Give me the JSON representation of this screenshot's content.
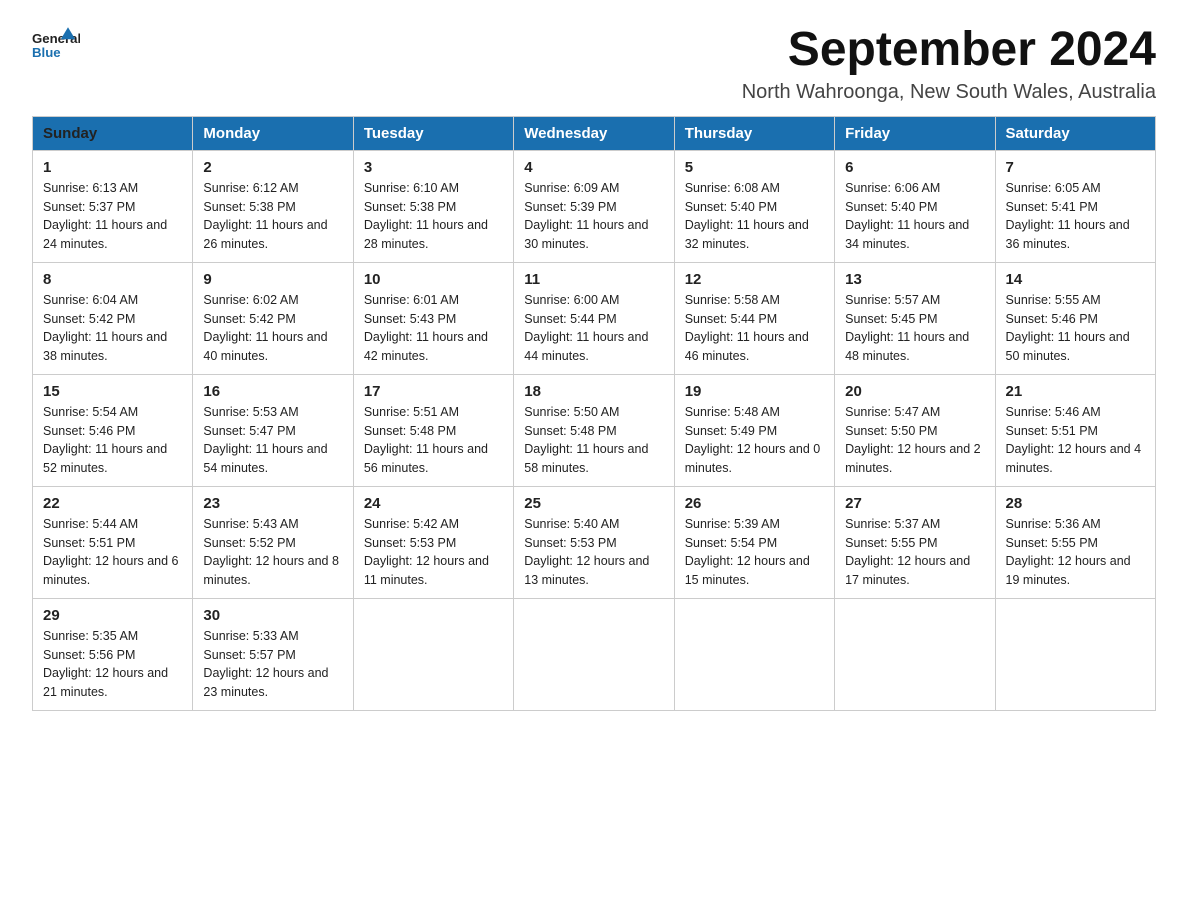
{
  "logo": {
    "general": "General",
    "blue": "Blue"
  },
  "title": "September 2024",
  "location": "North Wahroonga, New South Wales, Australia",
  "weekdays": [
    "Sunday",
    "Monday",
    "Tuesday",
    "Wednesday",
    "Thursday",
    "Friday",
    "Saturday"
  ],
  "weeks": [
    [
      {
        "day": "1",
        "sunrise": "6:13 AM",
        "sunset": "5:37 PM",
        "daylight": "11 hours and 24 minutes."
      },
      {
        "day": "2",
        "sunrise": "6:12 AM",
        "sunset": "5:38 PM",
        "daylight": "11 hours and 26 minutes."
      },
      {
        "day": "3",
        "sunrise": "6:10 AM",
        "sunset": "5:38 PM",
        "daylight": "11 hours and 28 minutes."
      },
      {
        "day": "4",
        "sunrise": "6:09 AM",
        "sunset": "5:39 PM",
        "daylight": "11 hours and 30 minutes."
      },
      {
        "day": "5",
        "sunrise": "6:08 AM",
        "sunset": "5:40 PM",
        "daylight": "11 hours and 32 minutes."
      },
      {
        "day": "6",
        "sunrise": "6:06 AM",
        "sunset": "5:40 PM",
        "daylight": "11 hours and 34 minutes."
      },
      {
        "day": "7",
        "sunrise": "6:05 AM",
        "sunset": "5:41 PM",
        "daylight": "11 hours and 36 minutes."
      }
    ],
    [
      {
        "day": "8",
        "sunrise": "6:04 AM",
        "sunset": "5:42 PM",
        "daylight": "11 hours and 38 minutes."
      },
      {
        "day": "9",
        "sunrise": "6:02 AM",
        "sunset": "5:42 PM",
        "daylight": "11 hours and 40 minutes."
      },
      {
        "day": "10",
        "sunrise": "6:01 AM",
        "sunset": "5:43 PM",
        "daylight": "11 hours and 42 minutes."
      },
      {
        "day": "11",
        "sunrise": "6:00 AM",
        "sunset": "5:44 PM",
        "daylight": "11 hours and 44 minutes."
      },
      {
        "day": "12",
        "sunrise": "5:58 AM",
        "sunset": "5:44 PM",
        "daylight": "11 hours and 46 minutes."
      },
      {
        "day": "13",
        "sunrise": "5:57 AM",
        "sunset": "5:45 PM",
        "daylight": "11 hours and 48 minutes."
      },
      {
        "day": "14",
        "sunrise": "5:55 AM",
        "sunset": "5:46 PM",
        "daylight": "11 hours and 50 minutes."
      }
    ],
    [
      {
        "day": "15",
        "sunrise": "5:54 AM",
        "sunset": "5:46 PM",
        "daylight": "11 hours and 52 minutes."
      },
      {
        "day": "16",
        "sunrise": "5:53 AM",
        "sunset": "5:47 PM",
        "daylight": "11 hours and 54 minutes."
      },
      {
        "day": "17",
        "sunrise": "5:51 AM",
        "sunset": "5:48 PM",
        "daylight": "11 hours and 56 minutes."
      },
      {
        "day": "18",
        "sunrise": "5:50 AM",
        "sunset": "5:48 PM",
        "daylight": "11 hours and 58 minutes."
      },
      {
        "day": "19",
        "sunrise": "5:48 AM",
        "sunset": "5:49 PM",
        "daylight": "12 hours and 0 minutes."
      },
      {
        "day": "20",
        "sunrise": "5:47 AM",
        "sunset": "5:50 PM",
        "daylight": "12 hours and 2 minutes."
      },
      {
        "day": "21",
        "sunrise": "5:46 AM",
        "sunset": "5:51 PM",
        "daylight": "12 hours and 4 minutes."
      }
    ],
    [
      {
        "day": "22",
        "sunrise": "5:44 AM",
        "sunset": "5:51 PM",
        "daylight": "12 hours and 6 minutes."
      },
      {
        "day": "23",
        "sunrise": "5:43 AM",
        "sunset": "5:52 PM",
        "daylight": "12 hours and 8 minutes."
      },
      {
        "day": "24",
        "sunrise": "5:42 AM",
        "sunset": "5:53 PM",
        "daylight": "12 hours and 11 minutes."
      },
      {
        "day": "25",
        "sunrise": "5:40 AM",
        "sunset": "5:53 PM",
        "daylight": "12 hours and 13 minutes."
      },
      {
        "day": "26",
        "sunrise": "5:39 AM",
        "sunset": "5:54 PM",
        "daylight": "12 hours and 15 minutes."
      },
      {
        "day": "27",
        "sunrise": "5:37 AM",
        "sunset": "5:55 PM",
        "daylight": "12 hours and 17 minutes."
      },
      {
        "day": "28",
        "sunrise": "5:36 AM",
        "sunset": "5:55 PM",
        "daylight": "12 hours and 19 minutes."
      }
    ],
    [
      {
        "day": "29",
        "sunrise": "5:35 AM",
        "sunset": "5:56 PM",
        "daylight": "12 hours and 21 minutes."
      },
      {
        "day": "30",
        "sunrise": "5:33 AM",
        "sunset": "5:57 PM",
        "daylight": "12 hours and 23 minutes."
      },
      null,
      null,
      null,
      null,
      null
    ]
  ],
  "labels": {
    "sunrise_prefix": "Sunrise: ",
    "sunset_prefix": "Sunset: ",
    "daylight_prefix": "Daylight: "
  }
}
